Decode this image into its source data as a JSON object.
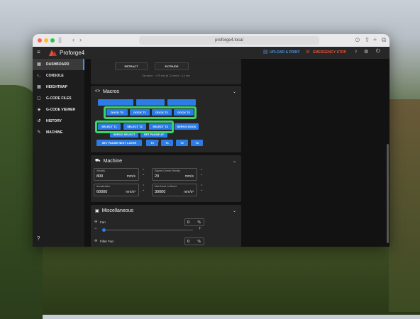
{
  "browser": {
    "url": "proforge4.local"
  },
  "app": {
    "title": "Proforge4",
    "upload_label": "UPLOAD & PRINT",
    "emergency_label": "EMERGENCY STOP"
  },
  "sidebar": {
    "items": [
      {
        "label": "DASHBOARD"
      },
      {
        "label": "CONSOLE"
      },
      {
        "label": "HEIGHTMAP"
      },
      {
        "label": "G-CODE FILES"
      },
      {
        "label": "G-CODE VIEWER"
      },
      {
        "label": "HISTORY"
      },
      {
        "label": "MACHINE"
      }
    ]
  },
  "extruder": {
    "retract_label": "RETRACT",
    "extrude_label": "EXTRUDE",
    "info": "Extrusion: ~ 479 mm @ 12 mm³/s · 0.4 mm"
  },
  "macros": {
    "title": "Macros",
    "row_top": [
      "",
      "",
      ""
    ],
    "dock_buttons": [
      "DOCK T0",
      "DOCK T1",
      "DOCK T2",
      "DOCK T3"
    ],
    "select_buttons": [
      "SELECT T1",
      "SELECT T2",
      "SELECT T3"
    ],
    "servo_dock_label": "SERVO DOCK",
    "servo_select_label": "SERVO SELECT",
    "pause_label": "SET PAUSE AT LAYER",
    "pause_next_label": "SET PAUSE NEXT LAYER",
    "tool_buttons": [
      "T0",
      "T1",
      "T2",
      "T3"
    ]
  },
  "machine": {
    "title": "Machine",
    "velocity": {
      "label": "Velocity",
      "value": "800",
      "unit": "mm/s"
    },
    "scv": {
      "label": "Square Corner Velocity",
      "value": "20",
      "unit": "mm/s"
    },
    "accel": {
      "label": "Acceleration",
      "value": "60000",
      "unit": "mm/s²"
    },
    "decel": {
      "label": "Max Accel. to Decel.",
      "value": "30000",
      "unit": "mm/s²"
    }
  },
  "misc": {
    "title": "Miscellaneous",
    "fan": {
      "label": "Fan",
      "value": "0",
      "unit": "%",
      "level": 0.0
    },
    "filter_fan": {
      "label": "Filter Fan",
      "value": "0",
      "unit": "%"
    }
  },
  "colors": {
    "accent": "#2d7be4",
    "highlight": "#37d36b",
    "danger": "#e0533a",
    "upload": "#4a90e2"
  }
}
